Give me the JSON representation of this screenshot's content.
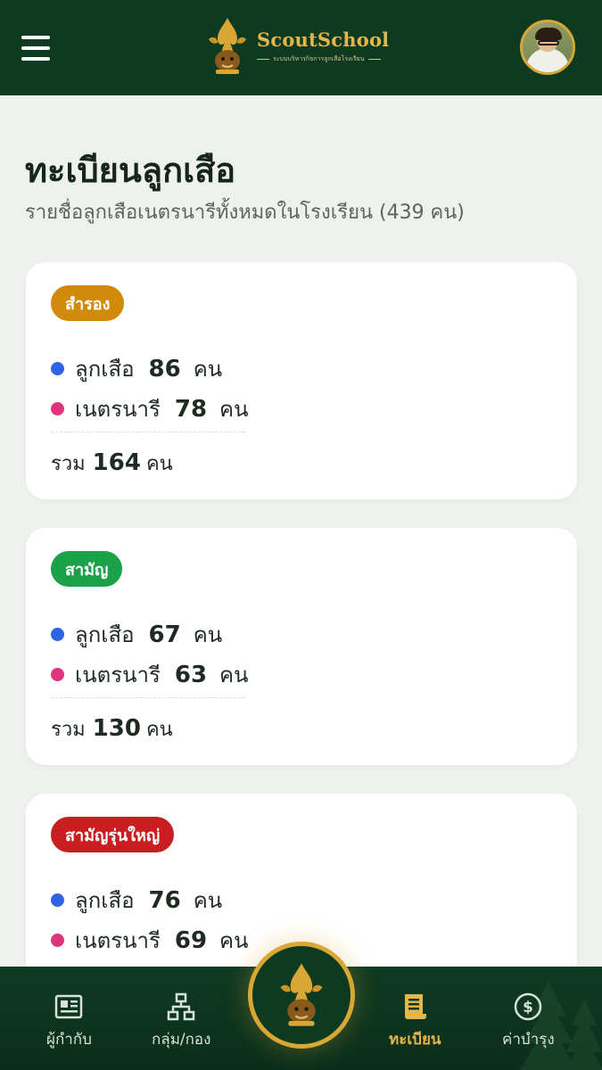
{
  "header": {
    "brand_name": "ScoutSchool",
    "brand_tagline": "ระบบบริหารกิจการลูกเสือโรงเรียน"
  },
  "page": {
    "title": "ทะเบียนลูกเสือ",
    "subtitle": "รายชื่อลูกเสือเนตรนารีทั้งหมดในโรงเรียน (439 คน)"
  },
  "colors": {
    "header_bg": "#0f3a22",
    "gold": "#d9a733",
    "boy_dot": "#2f63e6",
    "girl_dot": "#e0347f"
  },
  "groups": [
    {
      "label": "สำรอง",
      "badge_color": "#d18a0c",
      "boy_label": "ลูกเสือ",
      "boy_count": "86",
      "boy_unit": "คน",
      "girl_label": "เนตรนารี",
      "girl_count": "78",
      "girl_unit": "คน",
      "total_label": "รวม",
      "total_count": "164",
      "total_unit": "คน"
    },
    {
      "label": "สามัญ",
      "badge_color": "#1aa14a",
      "boy_label": "ลูกเสือ",
      "boy_count": "67",
      "boy_unit": "คน",
      "girl_label": "เนตรนารี",
      "girl_count": "63",
      "girl_unit": "คน",
      "total_label": "รวม",
      "total_count": "130",
      "total_unit": "คน"
    },
    {
      "label": "สามัญรุ่นใหญ่",
      "badge_color": "#c81e22",
      "boy_label": "ลูกเสือ",
      "boy_count": "76",
      "boy_unit": "คน",
      "girl_label": "เนตรนารี",
      "girl_count": "69",
      "girl_unit": "คน"
    }
  ],
  "nav": [
    {
      "label": "ผู้กำกับ",
      "icon": "id-card-icon"
    },
    {
      "label": "กลุ่ม/กอง",
      "icon": "hierarchy-icon"
    },
    {
      "label": "ทะเบียน",
      "icon": "register-icon",
      "active": true
    },
    {
      "label": "ค่าบำรุง",
      "icon": "dollar-coin-icon"
    }
  ]
}
